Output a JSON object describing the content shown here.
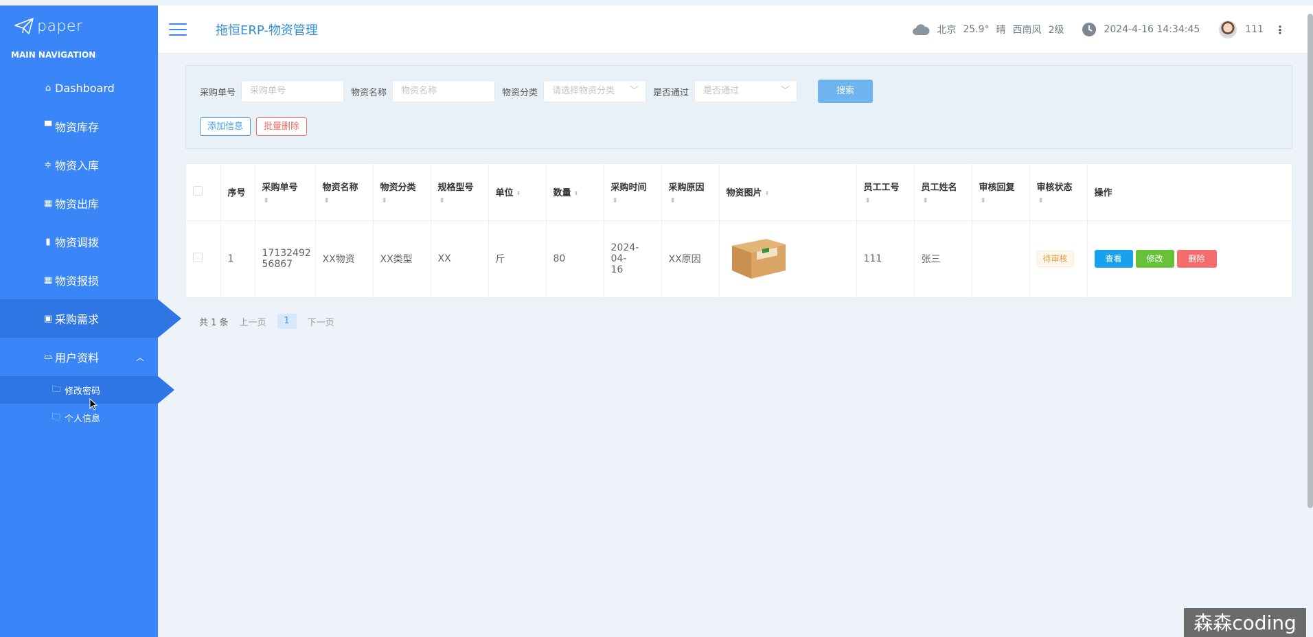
{
  "sidebar": {
    "logo_text": "paper",
    "nav_label": "MAIN NAVIGATION",
    "items": [
      {
        "label": "Dashboard",
        "icon": "home-icon"
      },
      {
        "label": "物资库存",
        "icon": "briefcase-icon"
      },
      {
        "label": "物资入库",
        "icon": "sliders-icon"
      },
      {
        "label": "物资出库",
        "icon": "grid-icon"
      },
      {
        "label": "物资调拨",
        "icon": "bar-chart-icon"
      },
      {
        "label": "物资报损",
        "icon": "grid-icon"
      },
      {
        "label": "采购需求",
        "icon": "clipboard-icon",
        "active": true
      },
      {
        "label": "用户资料",
        "icon": "card-icon",
        "expanded": true
      }
    ],
    "sub_items": [
      {
        "label": "修改密码",
        "icon": "folder-icon",
        "active": true
      },
      {
        "label": "个人信息",
        "icon": "folder-icon"
      }
    ]
  },
  "header": {
    "title": "拖恒ERP-物资管理",
    "city": "北京",
    "temp": "25.9°",
    "weather": "晴",
    "wind": "西南风",
    "wind_level": "2级",
    "datetime": "2024-4-16 14:34:45",
    "user": "111"
  },
  "filters": {
    "order_no_label": "采购单号",
    "order_no_placeholder": "采购单号",
    "name_label": "物资名称",
    "name_placeholder": "物资名称",
    "category_label": "物资分类",
    "category_placeholder": "请选择物资分类",
    "passed_label": "是否通过",
    "passed_placeholder": "是否通过",
    "search_button": "搜索",
    "add_button": "添加信息",
    "batch_delete_button": "批量删除"
  },
  "table": {
    "headers": [
      "序号",
      "采购单号",
      "物资名称",
      "物资分类",
      "规格型号",
      "单位",
      "数量",
      "采购时间",
      "采购原因",
      "物资图片",
      "员工工号",
      "员工姓名",
      "审核回复",
      "审核状态",
      "操作"
    ],
    "rows": [
      {
        "index": "1",
        "order_no_line1": "17132492",
        "order_no_line2": "56867",
        "name": "XX物资",
        "category": "XX类型",
        "spec": "XX",
        "unit": "斤",
        "quantity": "80",
        "date_line1": "2024-04-",
        "date_line2": "16",
        "reason": "XX原因",
        "emp_no": "111",
        "emp_name": "张三",
        "reply": "",
        "status": "待审核",
        "view": "查看",
        "edit": "修改",
        "delete": "删除"
      }
    ]
  },
  "pagination": {
    "total": "共 1 条",
    "prev": "上一页",
    "current": "1",
    "next": "下一页"
  },
  "watermark": "森森coding"
}
